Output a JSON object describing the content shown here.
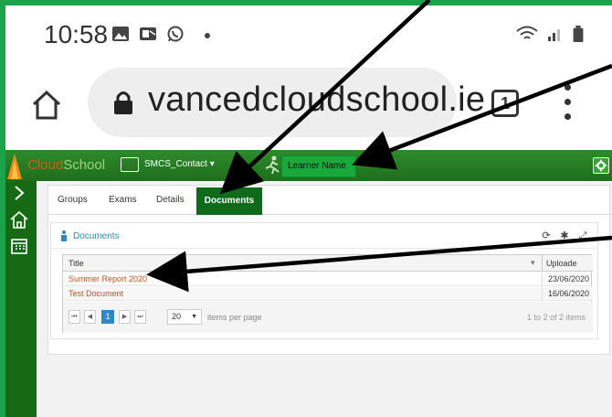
{
  "status_bar": {
    "time": "10:58"
  },
  "browser": {
    "url": "vancedcloudschool.ie",
    "tab_count": "1"
  },
  "app": {
    "logo": {
      "part1": "Cloud",
      "part2": "School"
    },
    "contact_label": "SMCS_Contact ▾",
    "learner_button": "Learner Name"
  },
  "tabs": {
    "items": [
      "Groups",
      "Exams",
      "Details"
    ],
    "active": "Documents"
  },
  "panel": {
    "title": "Documents",
    "tools": {
      "refresh": "⟳",
      "settings": "✱",
      "expand": "⤢"
    }
  },
  "grid": {
    "columns": {
      "title": "Title",
      "uploaded": "Uploade"
    },
    "rows": [
      {
        "title": "Summer Report 2020",
        "date": "23/06/2020"
      },
      {
        "title": "Test Document",
        "date": "16/06/2020"
      }
    ]
  },
  "pager": {
    "first": "⏮",
    "prev": "◀",
    "page": "1",
    "next": "▶",
    "last": "⏭",
    "page_size": "20",
    "items_per_page_label": "items per page",
    "count": "1 to 2 of 2 items"
  },
  "colors": {
    "frame": "#1aa34a",
    "header_green": "#2e8b2a",
    "active_tab": "#0f6a1a",
    "link_orange": "#c1501a",
    "pager_blue": "#2e88c8"
  }
}
